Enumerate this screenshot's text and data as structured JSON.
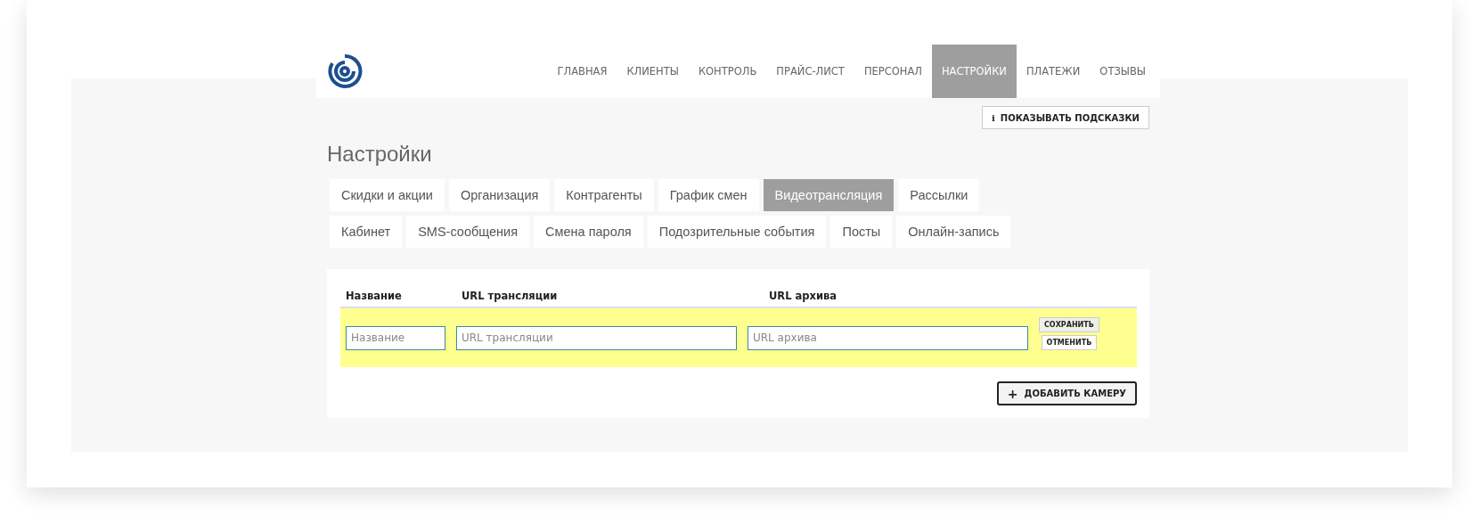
{
  "nav": [
    {
      "label": "ГЛАВНАЯ",
      "selected": false
    },
    {
      "label": "КЛИЕНТЫ",
      "selected": false
    },
    {
      "label": "КОНТРОЛЬ",
      "selected": false
    },
    {
      "label": "ПРАЙС-ЛИСТ",
      "selected": false
    },
    {
      "label": "ПЕРСОНАЛ",
      "selected": false
    },
    {
      "label": "НАСТРОЙКИ",
      "selected": true
    },
    {
      "label": "ПЛАТЕЖИ",
      "selected": false
    },
    {
      "label": "ОТЗЫВЫ",
      "selected": false
    }
  ],
  "hints_button": {
    "icon": "i",
    "label": "ПОКАЗЫВАТЬ ПОДСКАЗКИ"
  },
  "title": "Настройки",
  "tabs": [
    {
      "label": "Скидки и акции",
      "selected": false
    },
    {
      "label": "Организация",
      "selected": false
    },
    {
      "label": "Контрагенты",
      "selected": false
    },
    {
      "label": "График смен",
      "selected": false
    },
    {
      "label": "Видеотрансляция",
      "selected": true
    },
    {
      "label": "Рассылки",
      "selected": false
    },
    {
      "label": "Кабинет",
      "selected": false
    },
    {
      "label": "SMS-сообщения",
      "selected": false
    },
    {
      "label": "Смена пароля",
      "selected": false
    },
    {
      "label": "Подозрительные события",
      "selected": false
    },
    {
      "label": "Посты",
      "selected": false
    },
    {
      "label": "Онлайн-запись",
      "selected": false
    }
  ],
  "table": {
    "columns": [
      "Название",
      "URL трансляции",
      "URL архива"
    ],
    "edit_row": {
      "fields": [
        {
          "placeholder": "Название"
        },
        {
          "placeholder": "URL трансляции"
        },
        {
          "placeholder": "URL архива"
        }
      ],
      "save": "СОХРАНИТЬ",
      "cancel": "ОТМЕНИТЬ"
    }
  },
  "add_button": {
    "icon": "+",
    "label": "ДОБАВИТЬ КАМЕРУ"
  }
}
